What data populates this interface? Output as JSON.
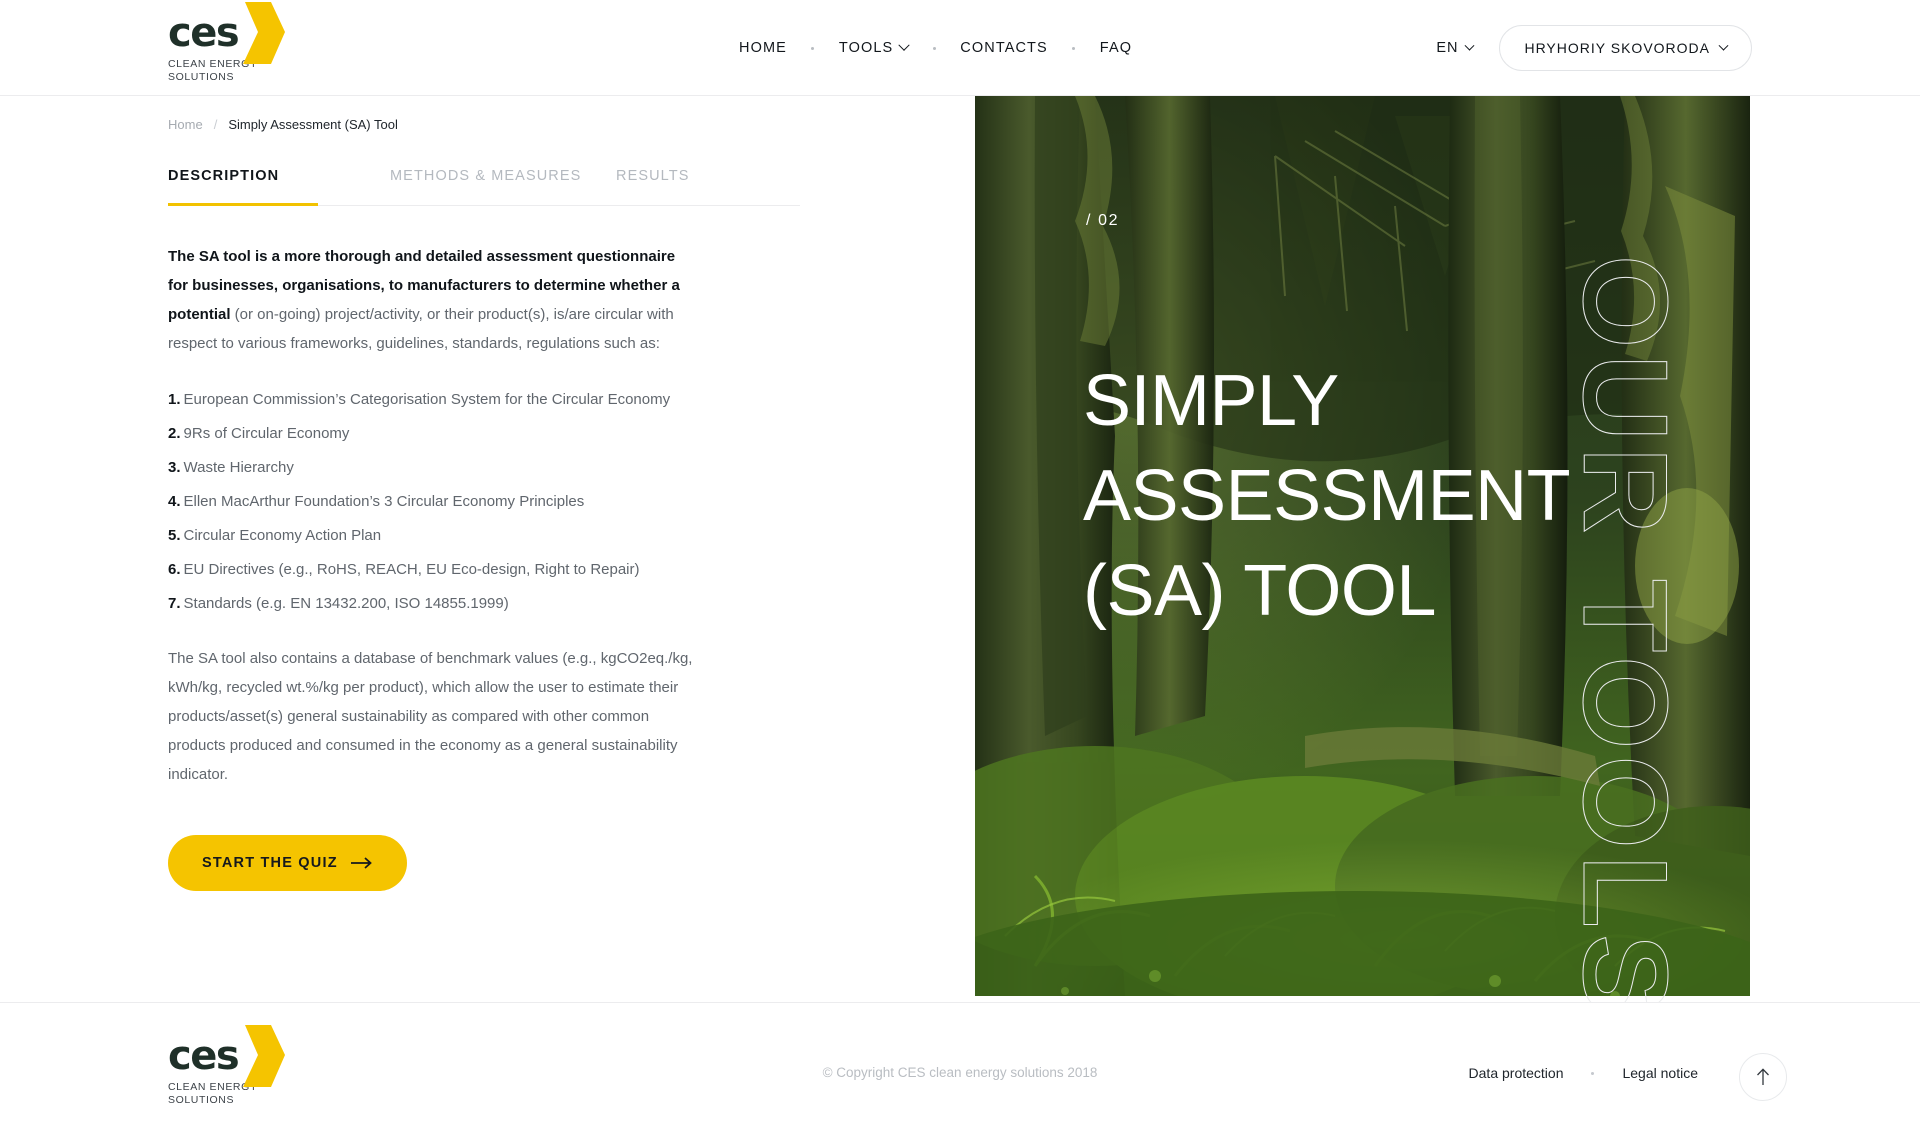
{
  "brand": {
    "logo_text": "ces",
    "logo_subtitle": "Clean Energy\nSolutions"
  },
  "header": {
    "nav": [
      {
        "label": "HOME",
        "has_caret": false
      },
      {
        "label": "TOOLS",
        "has_caret": true
      },
      {
        "label": "CONTACTS",
        "has_caret": false
      },
      {
        "label": "FAQ",
        "has_caret": false
      }
    ],
    "language": "EN",
    "user": "HRYHORIY SKOVORODA"
  },
  "breadcrumb": {
    "home": "Home",
    "separator": "/",
    "current": "Simply Assessment (SA) Tool"
  },
  "tabs": [
    {
      "label": "DESCRIPTION",
      "active": true
    },
    {
      "label": "METHODS & MEASURES",
      "active": false
    },
    {
      "label": "RESULTS",
      "active": false
    }
  ],
  "description": {
    "lead_bold": "The SA tool is a more thorough and detailed assessment questionnaire for businesses, organisations, to manufacturers to determine whether a potential",
    "lead_rest": " (or on-going) project/activity, or their product(s), is/are circular with respect to various frameworks, guidelines, standards, regulations such as:",
    "list": [
      {
        "n": "1.",
        "text": "European Commission’s Categorisation System for the Circular Economy"
      },
      {
        "n": "2.",
        "text": "9Rs of Circular Economy"
      },
      {
        "n": "3.",
        "text": "Waste Hierarchy"
      },
      {
        "n": "4.",
        "text": "Ellen MacArthur Foundation’s 3 Circular Economy Principles"
      },
      {
        "n": "5.",
        "text": "Circular Economy Action Plan"
      },
      {
        "n": "6.",
        "text": "EU Directives (e.g., RoHS, REACH, EU Eco-design, Right to Repair)"
      },
      {
        "n": "7.",
        "text": "Standards (e.g. EN 13432.200, ISO 14855.1999)"
      }
    ],
    "tail": "The SA tool also contains a database of benchmark values (e.g., kgCO2eq./kg, kWh/kg, recycled wt.%/kg per product), which allow the user to estimate their products/asset(s) general sustainability as compared with other common products produced and consumed in the economy as a general sustainability indicator.",
    "cta": "START THE QUIZ"
  },
  "hero": {
    "counter": "/ 02",
    "title": "Simply Assessment (SA) Tool",
    "side_text": "Our Tools"
  },
  "footer": {
    "copyright": "© Copyright CES clean energy solutions 2018",
    "links": [
      "Data protection",
      "Legal notice"
    ]
  },
  "colors": {
    "accent_yellow": "#f5c400",
    "logo_green": "#1f3029",
    "text_dark": "#10151a",
    "text_muted": "#60666d"
  }
}
